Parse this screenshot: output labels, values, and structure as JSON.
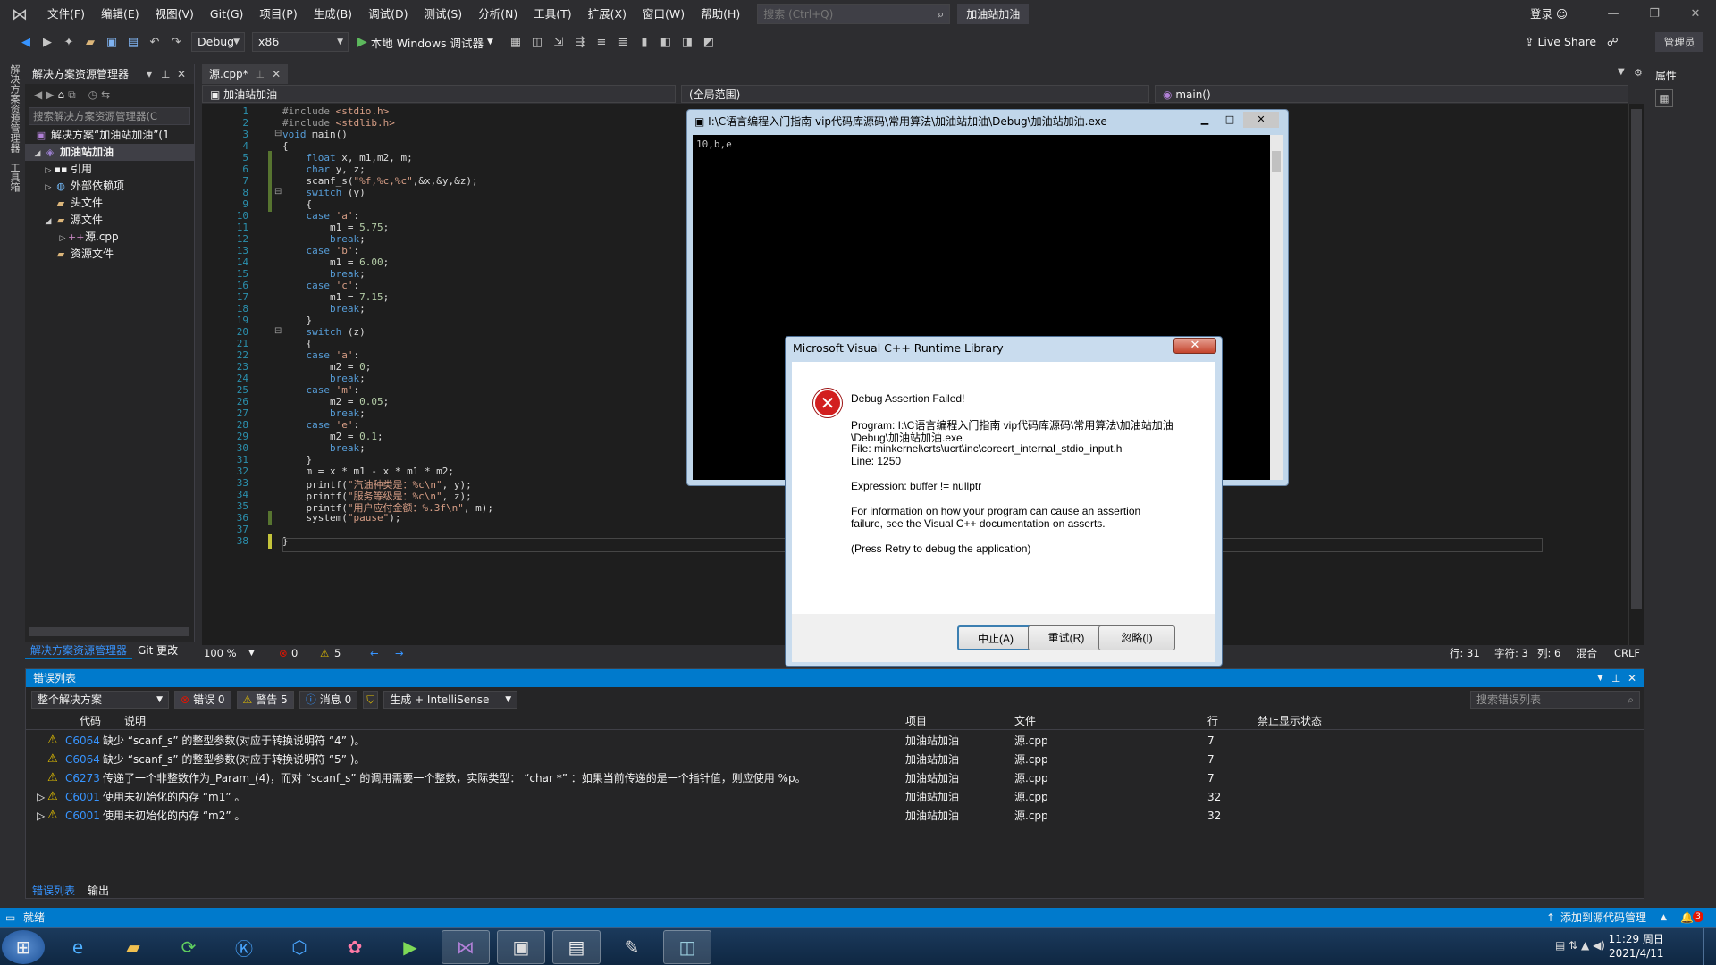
{
  "menu": {
    "items": [
      "文件(F)",
      "编辑(E)",
      "视图(V)",
      "Git(G)",
      "项目(P)",
      "生成(B)",
      "调试(D)",
      "测试(S)",
      "分析(N)",
      "工具(T)",
      "扩展(X)",
      "窗口(W)",
      "帮助(H)"
    ],
    "search_placeholder": "搜索 (Ctrl+Q)",
    "solution_name": "加油站加油",
    "login": "登录"
  },
  "toolbar": {
    "config": "Debug",
    "platform": "x86",
    "run_label": "本地 Windows 调试器",
    "live_share": "Live Share",
    "admin": "管理员"
  },
  "left_strip": {
    "tab1": "解决方案资源管理器",
    "tab2": "工具箱"
  },
  "solution_explorer": {
    "title": "解决方案资源管理器",
    "search_placeholder": "搜索解决方案资源管理器(C",
    "root": "解决方案“加油站加油”(1",
    "project": "加油站加油",
    "nodes": [
      "引用",
      "外部依赖项",
      "头文件",
      "源文件",
      "源.cpp",
      "资源文件"
    ],
    "tab_active": "解决方案资源管理器",
    "tab_other": "Git 更改"
  },
  "editor": {
    "file_tab": "源.cpp*",
    "nav_project": "加油站加油",
    "nav_scope": "(全局范围)",
    "nav_function": "main()",
    "lines": [
      "#include <stdio.h>",
      "#include <stdlib.h>",
      "void main()",
      "{",
      "    float x, m1,m2, m;",
      "    char y, z;",
      "    scanf_s(\"%f,%c,%c\",&x,&y,&z);",
      "    switch (y)",
      "    {",
      "    case 'a':",
      "        m1 = 5.75;",
      "        break;",
      "    case 'b':",
      "        m1 = 6.00;",
      "        break;",
      "    case 'c':",
      "        m1 = 7.15;",
      "        break;",
      "    }",
      "    switch (z)",
      "    {",
      "    case 'a':",
      "        m2 = 0;",
      "        break;",
      "    case 'm':",
      "        m2 = 0.05;",
      "        break;",
      "    case 'e':",
      "        m2 = 0.1;",
      "        break;",
      "    }",
      "    m = x * m1 - x * m1 * m2;",
      "    printf(\"汽油种类是：%c\\n\", y);",
      "    printf(\"服务等级是：%c\\n\", z);",
      "    printf(\"用户应付金额：%.3f\\n\", m);",
      "    system(\"pause\");",
      "",
      "}"
    ],
    "zoom": "100 %",
    "errors": "0",
    "warnings": "5",
    "row": "行: 31",
    "char": "字符: 3",
    "col": "列: 6",
    "mode": "混合",
    "eol": "CRLF"
  },
  "right_strip": {
    "properties": "属性"
  },
  "console": {
    "title": "I:\\C语言编程入门指南 vip代码库源码\\常用算法\\加油站加油\\Debug\\加油站加油.exe",
    "output": "10,b,e"
  },
  "dialog": {
    "title": "Microsoft Visual C++ Runtime Library",
    "heading": "Debug Assertion Failed!",
    "program_line1": "Program: I:\\C语言编程入门指南 vip代码库源码\\常用算法\\加油站加油",
    "program_line2": "\\Debug\\加油站加油.exe",
    "file": "File: minkernel\\crts\\ucrt\\inc\\corecrt_internal_stdio_input.h",
    "line": "Line: 1250",
    "expression": "Expression: buffer != nullptr",
    "info1": "For information on how your program can cause an assertion",
    "info2": "failure, see the Visual C++ documentation on asserts.",
    "retry_hint": "(Press Retry to debug the application)",
    "btn_abort": "中止(A)",
    "btn_retry": "重试(R)",
    "btn_ignore": "忽略(I)"
  },
  "error_list": {
    "title": "错误列表",
    "scope": "整个解决方案",
    "errors": "错误 0",
    "warnings": "警告 5",
    "messages": "消息 0",
    "build": "生成 + IntelliSense",
    "search_placeholder": "搜索错误列表",
    "columns": {
      "code": "代码",
      "desc": "说明",
      "project": "项目",
      "file": "文件",
      "line": "行",
      "suppress": "禁止显示状态"
    },
    "rows": [
      {
        "code": "C6064",
        "desc": "缺少 “scanf_s” 的整型参数(对应于转换说明符 “4” )。",
        "project": "加油站加油",
        "file": "源.cpp",
        "line": "7"
      },
      {
        "code": "C6064",
        "desc": "缺少 “scanf_s” 的整型参数(对应于转换说明符 “5” )。",
        "project": "加油站加油",
        "file": "源.cpp",
        "line": "7"
      },
      {
        "code": "C6273",
        "desc": "传递了一个非整数作为_Param_(4)，而对 “scanf_s” 的调用需要一个整数，实际类型： “char *” ：如果当前传递的是一个指针值，则应使用 %p。",
        "project": "加油站加油",
        "file": "源.cpp",
        "line": "7"
      },
      {
        "code": "C6001",
        "desc": "使用未初始化的内存 “m1” 。",
        "project": "加油站加油",
        "file": "源.cpp",
        "line": "32"
      },
      {
        "code": "C6001",
        "desc": "使用未初始化的内存 “m2” 。",
        "project": "加油站加油",
        "file": "源.cpp",
        "line": "32"
      }
    ],
    "tab_active": "错误列表",
    "tab_output": "输出"
  },
  "statusbar": {
    "ready": "就绪",
    "source_control": "添加到源代码管理",
    "notif_count": "3"
  },
  "taskbar": {
    "time": "11:29 周日",
    "date": "2021/4/11"
  }
}
